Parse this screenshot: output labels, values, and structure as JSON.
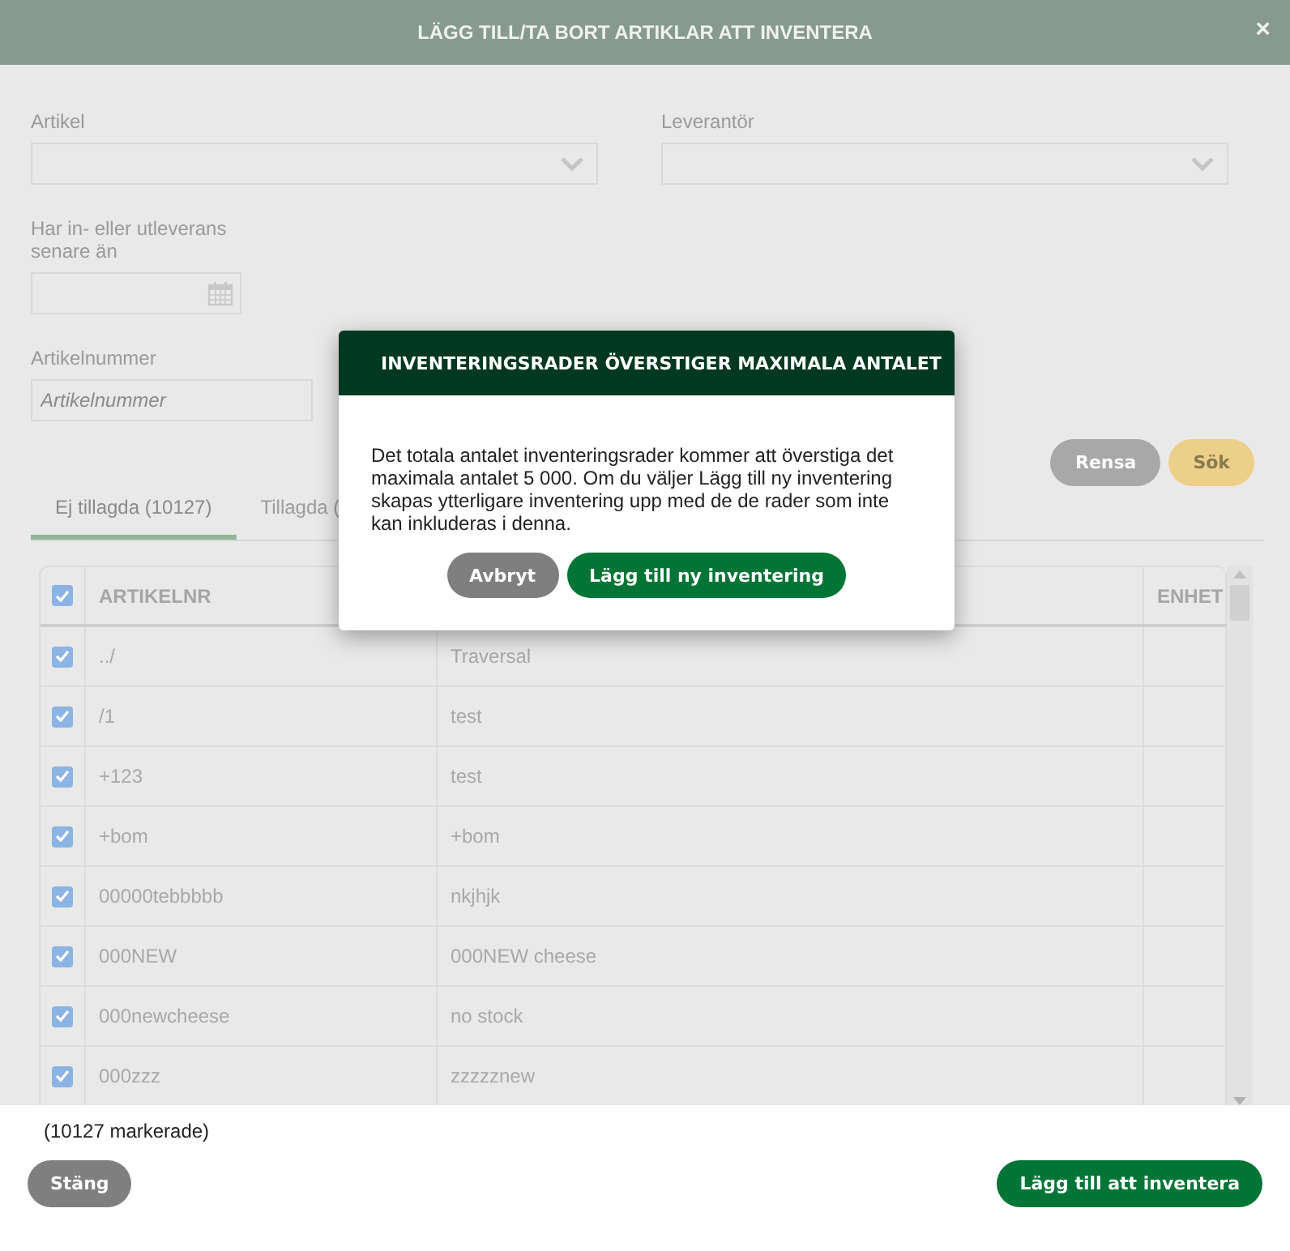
{
  "window": {
    "title": "LÄGG TILL/TA BORT ARTIKLAR ATT INVENTERA",
    "close": "×"
  },
  "filters": {
    "artikel": {
      "label": "Artikel"
    },
    "leverantor": {
      "label": "Leverantör"
    },
    "date": {
      "label": "Har in- eller utleverans senare än"
    },
    "artikelnummer": {
      "label": "Artikelnummer",
      "placeholder": "Artikelnummer"
    }
  },
  "actions": [
    {
      "label": "Rensa",
      "kind": "clear"
    },
    {
      "label": "Sök",
      "kind": "search"
    }
  ],
  "tabs": [
    {
      "label": "Ej tillagda (10127)",
      "selected": true
    },
    {
      "label": "Tillagda (",
      "selected": false
    }
  ],
  "table": {
    "header_checked": true,
    "columns": [
      "ARTIKELNR",
      "ENHET"
    ],
    "rows": [
      {
        "checked": true,
        "artikelnr": "../",
        "column_2": "Traversal"
      },
      {
        "checked": true,
        "artikelnr": "/1",
        "column_2": "test"
      },
      {
        "checked": true,
        "artikelnr": "+123",
        "column_2": "test"
      },
      {
        "checked": true,
        "artikelnr": "+bom",
        "column_2": "+bom"
      },
      {
        "checked": true,
        "artikelnr": "00000tebbbbb",
        "column_2": "nkjhjk"
      },
      {
        "checked": true,
        "artikelnr": "000NEW",
        "column_2": "000NEW cheese"
      },
      {
        "checked": true,
        "artikelnr": "000newcheese",
        "column_2": "no stock"
      },
      {
        "checked": true,
        "artikelnr": "000zzz",
        "column_2": "zzzzznew"
      }
    ]
  },
  "footer": {
    "selection_count": "(10127 markerade)",
    "buttons": [
      {
        "label": "Stäng",
        "kind": "secondary"
      },
      {
        "label": "Lägg till att inventera",
        "kind": "primary"
      }
    ]
  },
  "dialog": {
    "title": "INVENTERINGSRADER ÖVERSTIGER MAXIMALA ANTALET",
    "message": "Det totala antalet inventeringsrader kommer att överstiga det maximala antalet 5 000. Om du väljer Lägg till ny inventering skapas ytterligare inventering upp med de de rader som inte kan inkluderas i denna.",
    "buttons": [
      {
        "label": "Avbryt",
        "kind": "secondary"
      },
      {
        "label": "Lägg till ny inventering",
        "kind": "primary"
      }
    ]
  }
}
